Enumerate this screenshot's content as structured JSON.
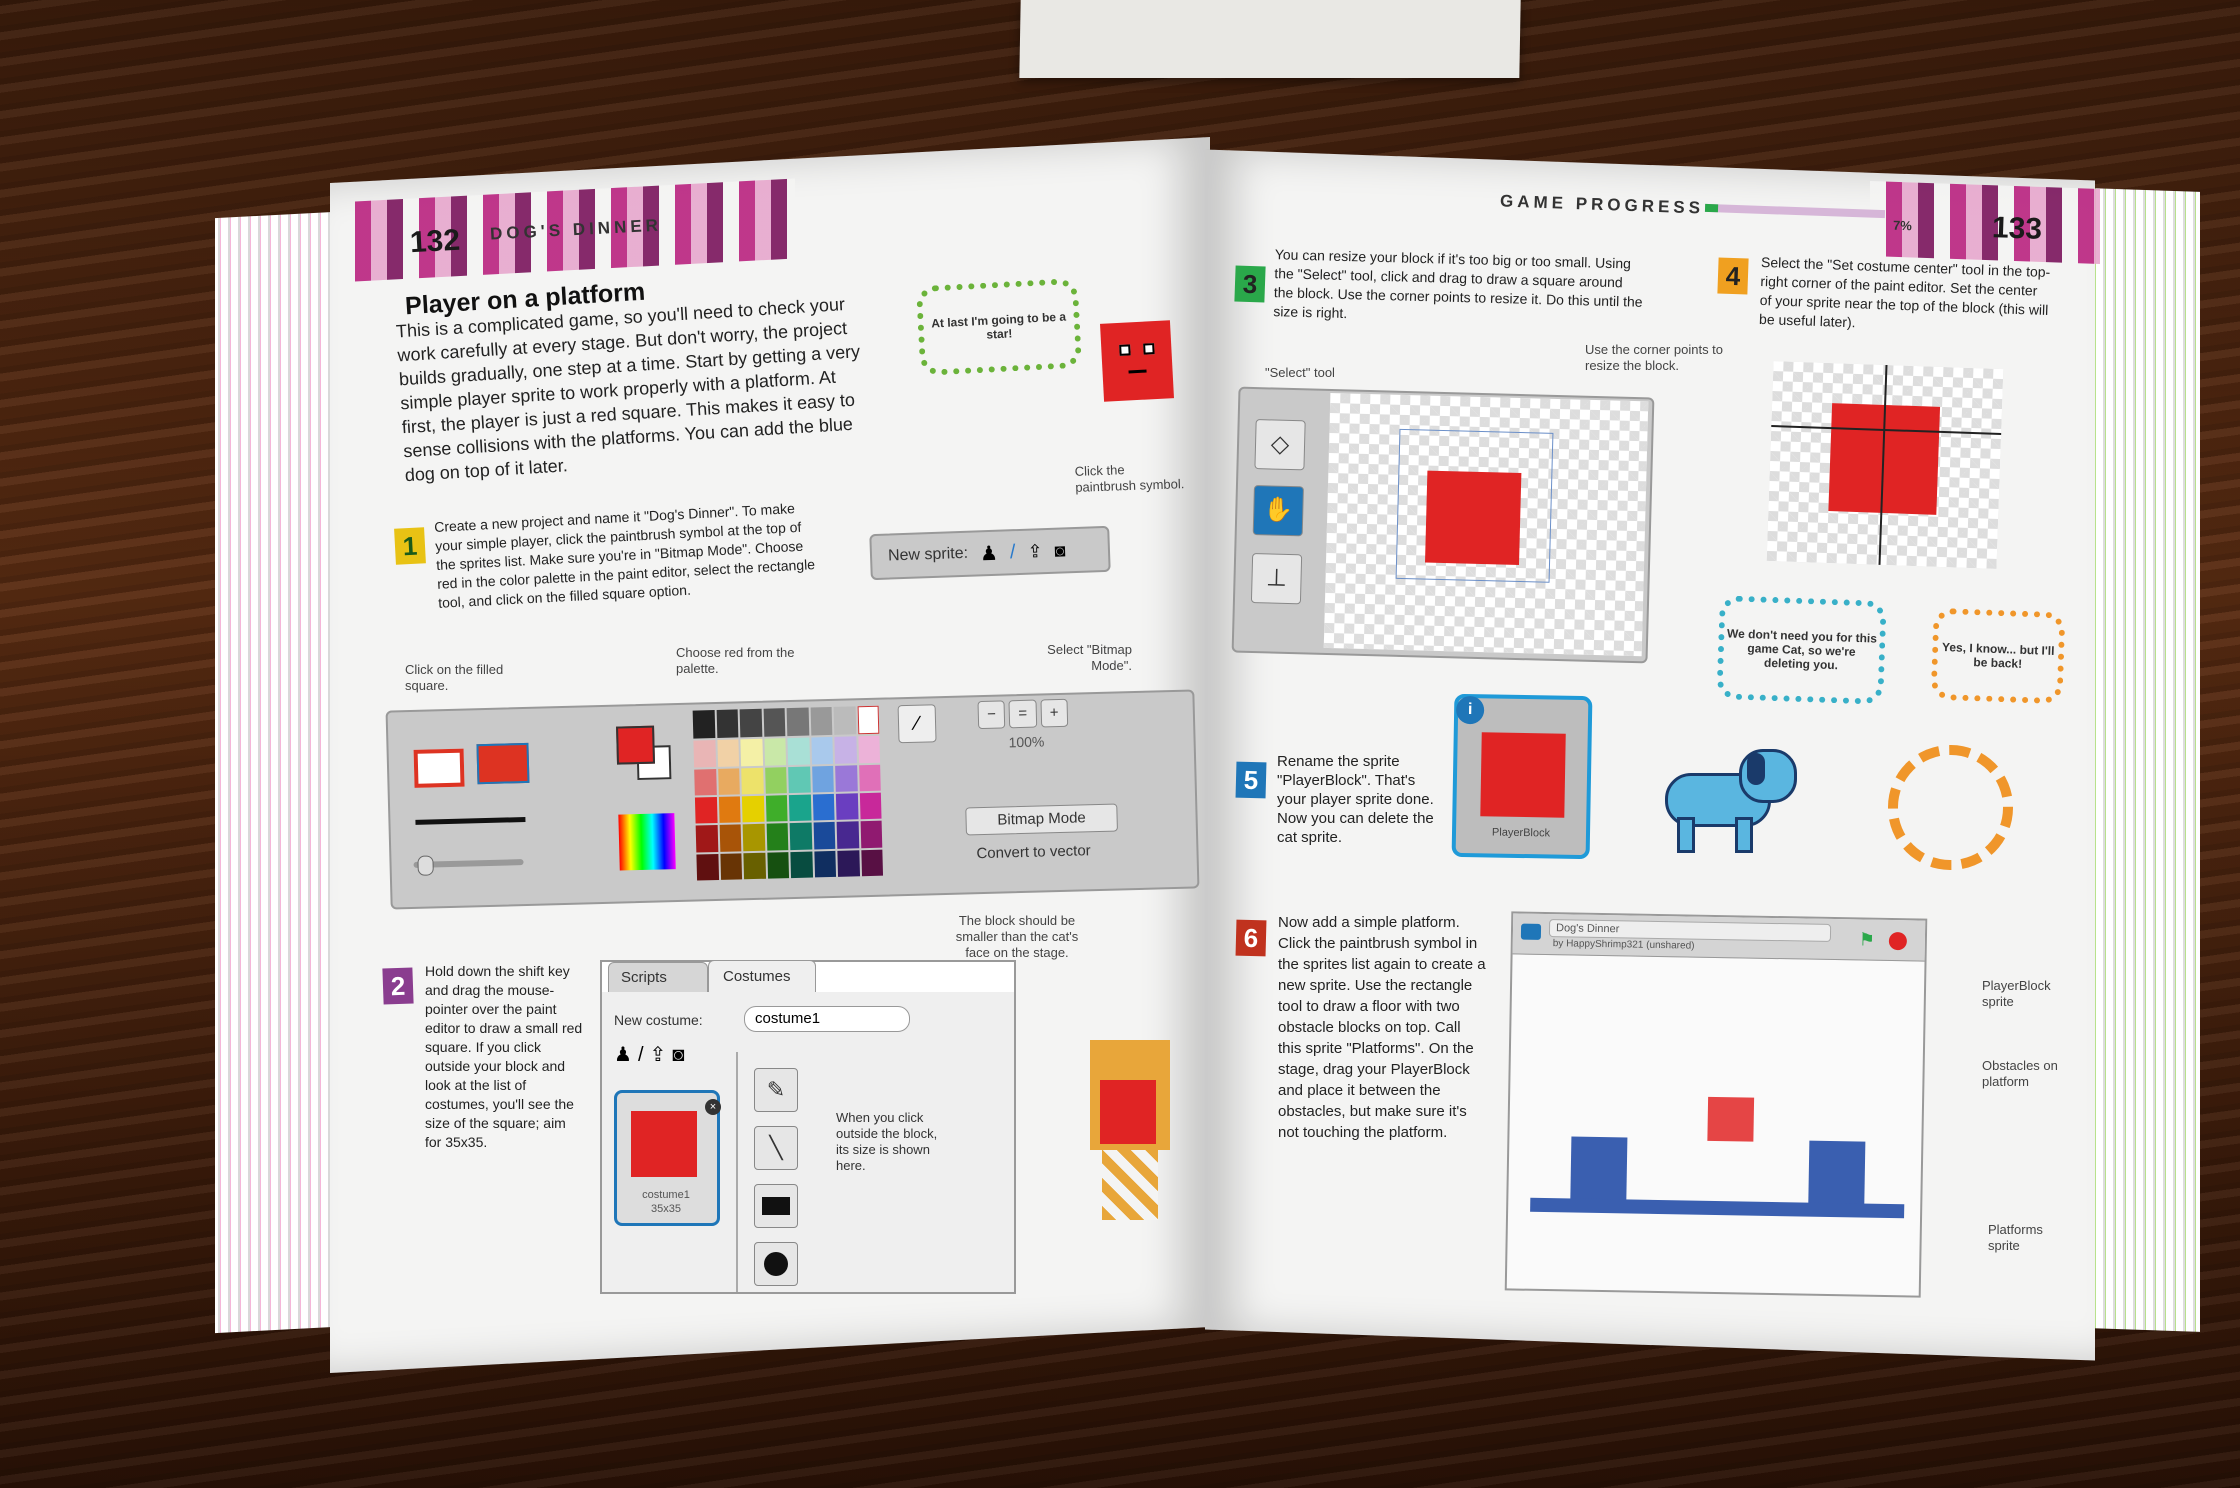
{
  "left_page": {
    "page_number": "132",
    "section": "DOG'S DINNER",
    "title": "Player on a platform",
    "intro": "This is a complicated game, so you'll need to check your work carefully at every stage. But don't worry, the project builds gradually, one step at a time. Start by getting a very simple player sprite to work properly with a platform. At first, the player is just a red square. This makes it easy to sense collisions with the platforms. You can add the blue dog on top of it later.",
    "bubble_text": "At last I'm going to be a star!",
    "step1": {
      "number": "1",
      "text": "Create a new project and name it \"Dog's Dinner\". To make your simple player, click the paintbrush symbol at the top of the sprites list. Make sure you're in \"Bitmap Mode\". Choose red in the color palette in the paint editor, select the rectangle tool, and click on the filled square option."
    },
    "new_sprite_label": "New sprite:",
    "cap_paintbrush": "Click the paintbrush symbol.",
    "cap_filled": "Click on the filled square.",
    "cap_red": "Choose red from the palette.",
    "cap_bitmap": "Select \"Bitmap Mode\".",
    "zoom": "100%",
    "bitmap_mode": "Bitmap Mode",
    "convert_vector": "Convert to vector",
    "step2": {
      "number": "2",
      "text": "Hold down the shift key and drag the mouse-pointer over the paint editor to draw a small red square. If you click outside your block and look at the list of costumes, you'll see the size of the square; aim for 35x35."
    },
    "tab_scripts": "Scripts",
    "tab_costumes": "Costumes",
    "new_costume_label": "New costume:",
    "costume_name": "costume1",
    "costume_size": "35x35",
    "cap_size": "When you click outside the block, its size is shown here.",
    "cap_smaller": "The block should be smaller than the cat's face on the stage."
  },
  "right_page": {
    "page_number": "133",
    "section": "GAME PROGRESS",
    "progress_percent": 7,
    "progress_label": "7%",
    "step3": {
      "number": "3",
      "text": "You can resize your block if it's too big or too small. Using the \"Select\" tool, click and drag to draw a square around the block. Use the corner points to resize it. Do this until the size is right."
    },
    "cap_select": "\"Select\" tool",
    "cap_corner": "Use the corner points to resize the block.",
    "step4": {
      "number": "4",
      "text": "Select the \"Set costume center\" tool in the top-right corner of the paint editor. Set the center of your sprite near the top of the block (this will be useful later)."
    },
    "bubble_cyan": "We don't need you for this game Cat, so we're deleting you.",
    "bubble_orange": "Yes, I know... but I'll be back!",
    "step5": {
      "number": "5",
      "text": "Rename the sprite \"PlayerBlock\". That's your player sprite done. Now you can delete the cat sprite."
    },
    "sprite_name": "PlayerBlock",
    "step6": {
      "number": "6",
      "text": "Now add a simple platform. Click the paintbrush symbol in the sprites list again to create a new sprite. Use the rectangle tool to draw a floor with two obstacle blocks on top. Call this sprite \"Platforms\". On the stage, drag your PlayerBlock and place it between the obstacles, but make sure it's not touching the platform."
    },
    "stage_title": "Dog's Dinner",
    "stage_author": "by HappyShrimp321 (unshared)",
    "cap_playerblock": "PlayerBlock sprite",
    "cap_obstacles": "Obstacles on platform",
    "cap_platforms": "Platforms sprite"
  },
  "colors": {
    "accent_magenta": "#b9227f",
    "block_red": "#e02424",
    "platform_blue": "#3a5fb0",
    "step_green": "#8fbf2a",
    "step_yellow": "#e8c214",
    "step_purple": "#8a3d8f",
    "step_orange": "#f0a020",
    "step_blue": "#1f76b8",
    "step_red": "#c0321e"
  }
}
